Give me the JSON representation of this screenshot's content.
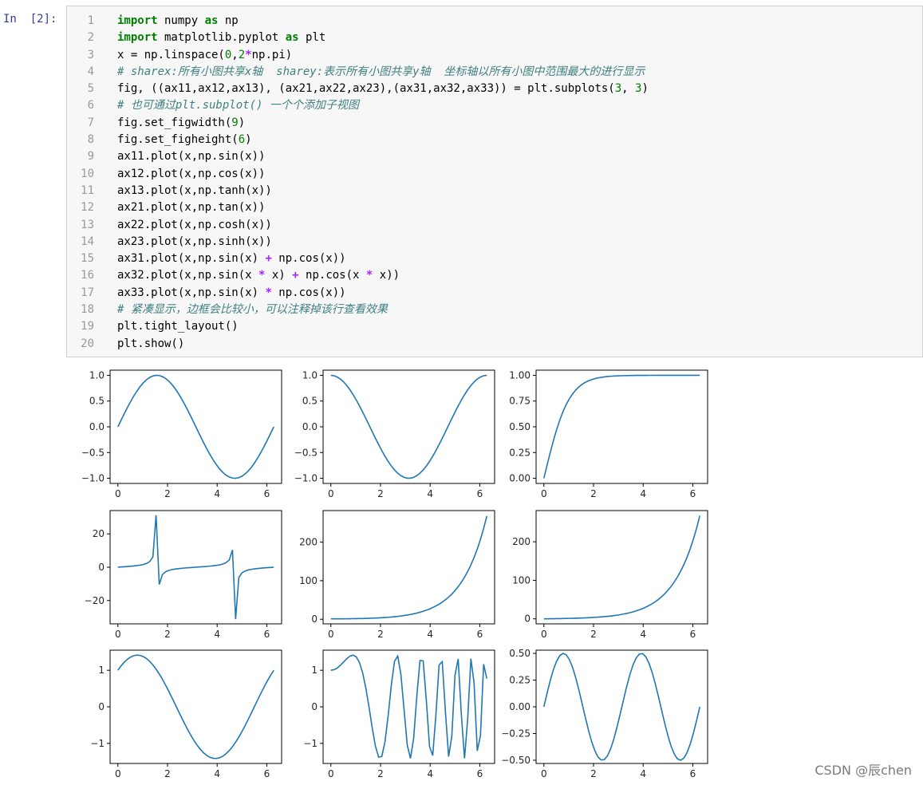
{
  "cell": {
    "prompt": "In  [2]:",
    "line_numbers": [
      "1",
      "2",
      "3",
      "4",
      "5",
      "6",
      "7",
      "8",
      "9",
      "10",
      "11",
      "12",
      "13",
      "14",
      "15",
      "16",
      "17",
      "18",
      "19",
      "20"
    ],
    "lines": [
      [
        {
          "t": "import",
          "k": "kw"
        },
        {
          "t": " numpy ",
          "k": "nm"
        },
        {
          "t": "as",
          "k": "kw"
        },
        {
          "t": " np",
          "k": "nm"
        }
      ],
      [
        {
          "t": "import",
          "k": "kw"
        },
        {
          "t": " matplotlib.pyplot ",
          "k": "nm"
        },
        {
          "t": "as",
          "k": "kw"
        },
        {
          "t": " plt",
          "k": "nm"
        }
      ],
      [
        {
          "t": "x = np.linspace(",
          "k": "nm"
        },
        {
          "t": "0",
          "k": "num"
        },
        {
          "t": ",",
          "k": "nm"
        },
        {
          "t": "2",
          "k": "num"
        },
        {
          "t": "*",
          "k": "op"
        },
        {
          "t": "np.pi)",
          "k": "nm"
        }
      ],
      [
        {
          "t": "# sharex:所有小图共享x轴  sharey:表示所有小图共享y轴  坐标轴以所有小图中范围最大的进行显示",
          "k": "cm"
        }
      ],
      [
        {
          "t": "fig, ((ax11,ax12,ax13), (ax21,ax22,ax23),(ax31,ax32,ax33)) = plt.subplots(",
          "k": "nm"
        },
        {
          "t": "3",
          "k": "num"
        },
        {
          "t": ", ",
          "k": "nm"
        },
        {
          "t": "3",
          "k": "num"
        },
        {
          "t": ")",
          "k": "nm"
        }
      ],
      [
        {
          "t": "# 也可通过plt.subplot() 一个个添加子视图",
          "k": "cm"
        }
      ],
      [
        {
          "t": "fig.set_figwidth(",
          "k": "nm"
        },
        {
          "t": "9",
          "k": "num"
        },
        {
          "t": ")",
          "k": "nm"
        }
      ],
      [
        {
          "t": "fig.set_figheight(",
          "k": "nm"
        },
        {
          "t": "6",
          "k": "num"
        },
        {
          "t": ")",
          "k": "nm"
        }
      ],
      [
        {
          "t": "ax11.plot(x,np.sin(x))",
          "k": "nm"
        }
      ],
      [
        {
          "t": "ax12.plot(x,np.cos(x))",
          "k": "nm"
        }
      ],
      [
        {
          "t": "ax13.plot(x,np.tanh(x))",
          "k": "nm"
        }
      ],
      [
        {
          "t": "ax21.plot(x,np.tan(x))",
          "k": "nm"
        }
      ],
      [
        {
          "t": "ax22.plot(x,np.cosh(x))",
          "k": "nm"
        }
      ],
      [
        {
          "t": "ax23.plot(x,np.sinh(x))",
          "k": "nm"
        }
      ],
      [
        {
          "t": "ax31.plot(x,np.sin(x) ",
          "k": "nm"
        },
        {
          "t": "+",
          "k": "op"
        },
        {
          "t": " np.cos(x))",
          "k": "nm"
        }
      ],
      [
        {
          "t": "ax32.plot(x,np.sin(x ",
          "k": "nm"
        },
        {
          "t": "*",
          "k": "op"
        },
        {
          "t": " x) ",
          "k": "nm"
        },
        {
          "t": "+",
          "k": "op"
        },
        {
          "t": " np.cos(x ",
          "k": "nm"
        },
        {
          "t": "*",
          "k": "op"
        },
        {
          "t": " x))",
          "k": "nm"
        }
      ],
      [
        {
          "t": "ax33.plot(x,np.sin(x) ",
          "k": "nm"
        },
        {
          "t": "*",
          "k": "op"
        },
        {
          "t": " np.cos(x))",
          "k": "nm"
        }
      ],
      [
        {
          "t": "# 紧凑显示，边框会比较小，可以注释掉该行查看效果",
          "k": "cm"
        }
      ],
      [
        {
          "t": "plt.tight_layout()",
          "k": "nm"
        }
      ],
      [
        {
          "t": "plt.show()",
          "k": "nm"
        }
      ]
    ]
  },
  "watermark": "CSDN @辰chen",
  "chart_data": [
    {
      "type": "line",
      "func": "sin",
      "x_range": [
        0,
        6.283185
      ],
      "n_points": 50,
      "ylim": [
        -1.1,
        1.1
      ],
      "xticks": [
        "0",
        "2",
        "4",
        "6"
      ],
      "yticks": [
        "1.0",
        "0.5",
        "0.0",
        "−0.5",
        "−1.0"
      ],
      "ytick_values": [
        1,
        0.5,
        0,
        -0.5,
        -1
      ],
      "line_color": "#1f77b4"
    },
    {
      "type": "line",
      "func": "cos",
      "x_range": [
        0,
        6.283185
      ],
      "n_points": 50,
      "ylim": [
        -1.1,
        1.1
      ],
      "xticks": [
        "0",
        "2",
        "4",
        "6"
      ],
      "yticks": [
        "1.0",
        "0.5",
        "0.0",
        "−0.5",
        "−1.0"
      ],
      "ytick_values": [
        1,
        0.5,
        0,
        -0.5,
        -1
      ],
      "line_color": "#1f77b4"
    },
    {
      "type": "line",
      "func": "tanh",
      "x_range": [
        0,
        6.283185
      ],
      "n_points": 50,
      "ylim": [
        -0.05,
        1.05
      ],
      "xticks": [
        "0",
        "2",
        "4",
        "6"
      ],
      "yticks": [
        "1.00",
        "0.75",
        "0.50",
        "0.25",
        "0.00"
      ],
      "ytick_values": [
        1,
        0.75,
        0.5,
        0.25,
        0
      ],
      "line_color": "#1f77b4"
    },
    {
      "type": "line",
      "func": "tan",
      "x_range": [
        0,
        6.283185
      ],
      "n_points": 50,
      "ylim": [
        -34,
        34
      ],
      "xticks": [
        "0",
        "2",
        "4",
        "6"
      ],
      "yticks": [
        "20",
        "0",
        "−20"
      ],
      "ytick_values": [
        20,
        0,
        -20
      ],
      "line_color": "#1f77b4"
    },
    {
      "type": "line",
      "func": "cosh",
      "x_range": [
        0,
        6.283185
      ],
      "n_points": 50,
      "ylim": [
        -12,
        282
      ],
      "xticks": [
        "0",
        "2",
        "4",
        "6"
      ],
      "yticks": [
        "200",
        "100",
        "0"
      ],
      "ytick_values": [
        200,
        100,
        0
      ],
      "line_color": "#1f77b4"
    },
    {
      "type": "line",
      "func": "sinh",
      "x_range": [
        0,
        6.283185
      ],
      "n_points": 50,
      "ylim": [
        -13,
        281
      ],
      "xticks": [
        "0",
        "2",
        "4",
        "6"
      ],
      "yticks": [
        "200",
        "100",
        "0"
      ],
      "ytick_values": [
        200,
        100,
        0
      ],
      "line_color": "#1f77b4"
    },
    {
      "type": "line",
      "func": "sin_plus_cos",
      "x_range": [
        0,
        6.283185
      ],
      "n_points": 50,
      "ylim": [
        -1.55,
        1.55
      ],
      "xticks": [
        "0",
        "2",
        "4",
        "6"
      ],
      "yticks": [
        "1",
        "0",
        "−1"
      ],
      "ytick_values": [
        1,
        0,
        -1
      ],
      "line_color": "#1f77b4"
    },
    {
      "type": "line",
      "func": "sin_xx_plus_cos_xx",
      "x_range": [
        0,
        6.283185
      ],
      "n_points": 50,
      "ylim": [
        -1.55,
        1.55
      ],
      "xticks": [
        "0",
        "2",
        "4",
        "6"
      ],
      "yticks": [
        "1",
        "0",
        "−1"
      ],
      "ytick_values": [
        1,
        0,
        -1
      ],
      "line_color": "#1f77b4"
    },
    {
      "type": "line",
      "func": "sin_times_cos",
      "x_range": [
        0,
        6.283185
      ],
      "n_points": 50,
      "ylim": [
        -0.53,
        0.53
      ],
      "xticks": [
        "0",
        "2",
        "4",
        "6"
      ],
      "yticks": [
        "0.50",
        "0.25",
        "0.00",
        "−0.25",
        "−0.50"
      ],
      "ytick_values": [
        0.5,
        0.25,
        0,
        -0.25,
        -0.5
      ],
      "line_color": "#1f77b4"
    }
  ]
}
